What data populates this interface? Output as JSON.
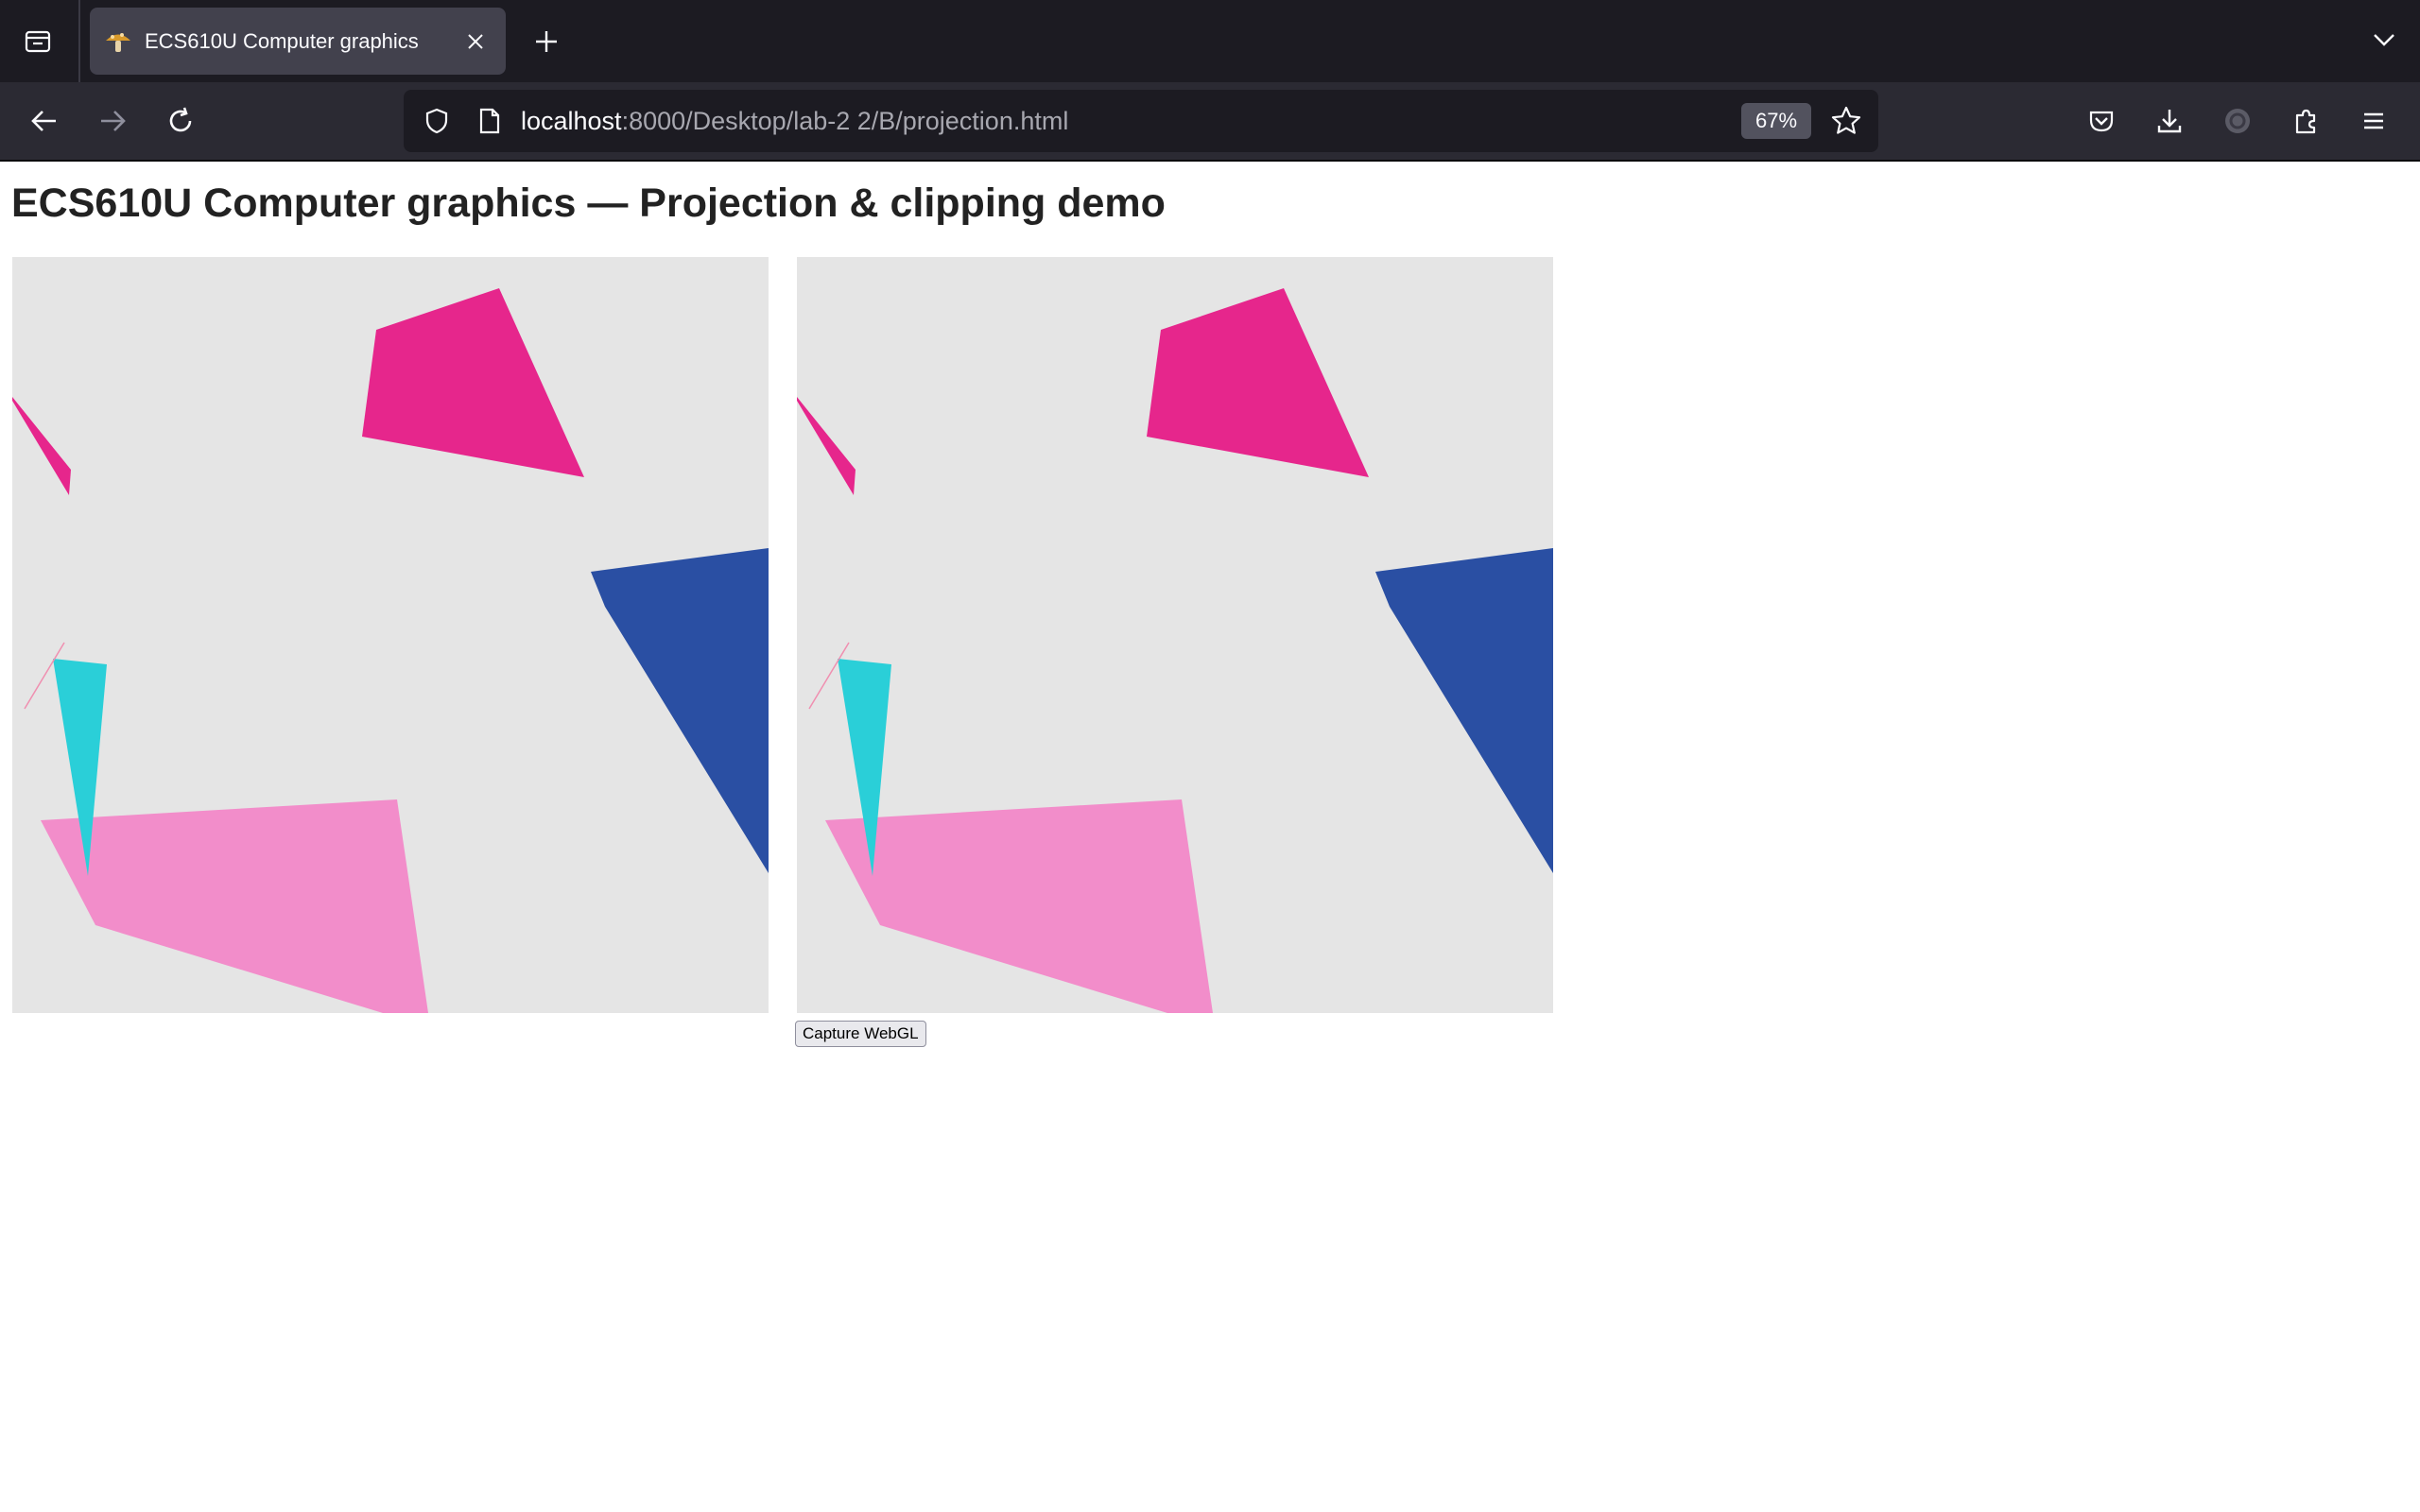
{
  "browser": {
    "tab": {
      "title": "ECS610U Computer graphics"
    },
    "url": {
      "host": "localhost",
      "rest": ":8000/Desktop/lab-2 2/B/projection.html"
    },
    "zoom": "67%"
  },
  "page": {
    "heading": "ECS610U Computer graphics — Projection & clipping demo",
    "canvas_background": "#e5e5e5",
    "shape_colors": {
      "magenta": "#e6268c",
      "pink": "#f28dca",
      "blue": "#2a4fa3",
      "cyan": "#2acfd8",
      "thin_pink_line": "#f08fb0"
    },
    "capture_button_label": "Capture WebGL"
  }
}
